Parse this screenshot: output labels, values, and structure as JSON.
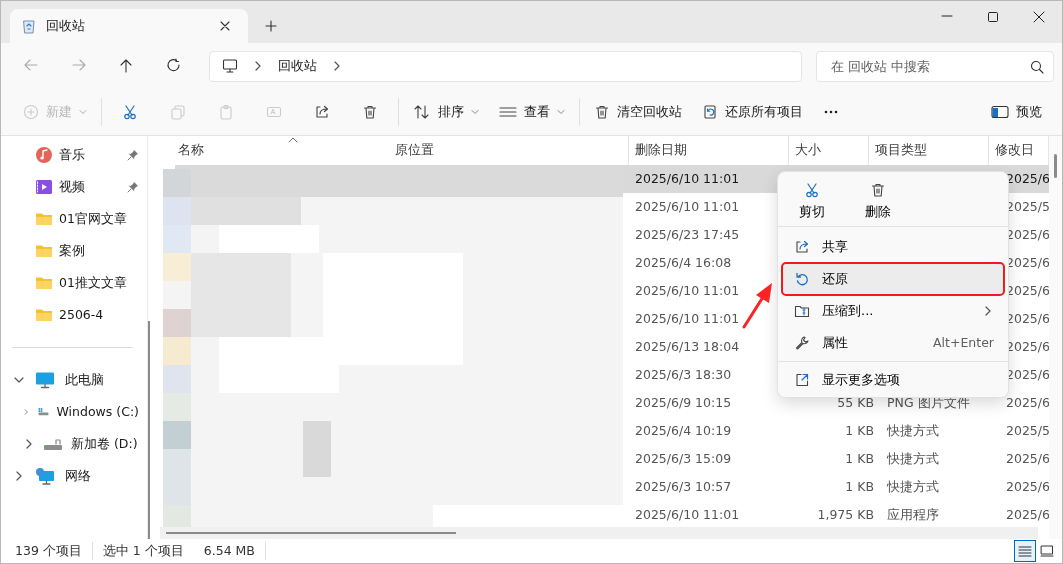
{
  "window": {
    "tab_title": "回收站"
  },
  "address": {
    "crumbs": [
      "回收站"
    ],
    "search_placeholder": "在 回收站 中搜索"
  },
  "toolbar": [
    {
      "kind": "new",
      "label": "新建",
      "disabled": true
    },
    {
      "kind": "cut",
      "disabled": false
    },
    {
      "kind": "copy",
      "disabled": true
    },
    {
      "kind": "paste",
      "disabled": true
    },
    {
      "kind": "rename",
      "disabled": true
    },
    {
      "kind": "share",
      "disabled": false
    },
    {
      "kind": "delete",
      "disabled": false
    },
    {
      "kind": "sort",
      "label": "排序",
      "disabled": false
    },
    {
      "kind": "view",
      "label": "查看",
      "disabled": false
    },
    {
      "kind": "empty",
      "label": "清空回收站",
      "disabled": false
    },
    {
      "kind": "restore_all",
      "label": "还原所有项目",
      "disabled": false
    },
    {
      "kind": "more",
      "disabled": false
    }
  ],
  "preview": {
    "label": "预览"
  },
  "sidebar": {
    "quick": [
      {
        "kind": "music",
        "label": "音乐",
        "pinned": true
      },
      {
        "kind": "video",
        "label": "视频",
        "pinned": true
      },
      {
        "kind": "folder",
        "label": "01官网文章",
        "pinned": false
      },
      {
        "kind": "folder",
        "label": "案例",
        "pinned": false
      },
      {
        "kind": "folder",
        "label": "01推文文章",
        "pinned": false
      },
      {
        "kind": "folder",
        "label": "2506-4",
        "pinned": false
      }
    ],
    "tree": [
      {
        "kind": "pc",
        "label": "此电脑",
        "expanded": true,
        "children": [
          {
            "kind": "drive_c",
            "label": "Windows (C:)",
            "expanded": false
          },
          {
            "kind": "drive",
            "label": "新加卷 (D:)",
            "expanded": false
          }
        ]
      },
      {
        "kind": "network",
        "label": "网络",
        "expanded": false
      }
    ]
  },
  "table": {
    "columns": [
      "名称",
      "原位置",
      "删除日期",
      "大小",
      "项目类型",
      "修改日"
    ],
    "rows": [
      {
        "deleted": "2025/6/10 11:01",
        "modified": "2025/6",
        "selected": true
      },
      {
        "deleted": "2025/6/10 11:01",
        "modified": "2025/5",
        "selected": false
      },
      {
        "deleted": "2025/6/23 17:45",
        "modified": "2025/6",
        "selected": false
      },
      {
        "deleted": "2025/6/4 16:08",
        "modified": "2025/6",
        "selected": false
      },
      {
        "deleted": "2025/6/10 11:01",
        "modified": "2025/6",
        "selected": false
      },
      {
        "deleted": "2025/6/10 11:01",
        "modified": "2025/6",
        "selected": false
      },
      {
        "deleted": "2025/6/13 18:04",
        "modified": "2025/6",
        "selected": false
      },
      {
        "deleted": "2025/6/3 18:30",
        "modified": "2025/6",
        "selected": false
      },
      {
        "deleted": "2025/6/9 10:15",
        "size": "55 KB",
        "type": "PNG 图片文件",
        "modified": "2025/6",
        "selected": false
      },
      {
        "deleted": "2025/6/4 10:19",
        "size": "1 KB",
        "type": "快捷方式",
        "modified": "2025/5",
        "selected": false
      },
      {
        "deleted": "2025/6/3 15:09",
        "size": "1 KB",
        "type": "快捷方式",
        "modified": "2025/6",
        "selected": false
      },
      {
        "deleted": "2025/6/3 10:57",
        "size": "1 KB",
        "type": "快捷方式",
        "modified": "2025/6",
        "selected": false
      },
      {
        "deleted": "2025/6/10 11:01",
        "size": "1,975 KB",
        "type": "应用程序",
        "modified": "2025/6",
        "selected": false
      }
    ]
  },
  "context_menu": {
    "top_actions": [
      {
        "kind": "cut",
        "label": "剪切"
      },
      {
        "kind": "delete",
        "label": "删除"
      }
    ],
    "items": [
      {
        "kind": "share",
        "label": "共享",
        "highlighted": false
      },
      {
        "kind": "restore",
        "label": "还原",
        "highlighted": true
      },
      {
        "kind": "compress",
        "label": "压缩到...",
        "submenu": true,
        "highlighted": false
      },
      {
        "kind": "properties",
        "label": "属性",
        "shortcut": "Alt+Enter",
        "highlighted": false
      },
      {
        "kind": "more_options",
        "label": "显示更多选项",
        "separator_before": true,
        "highlighted": false
      }
    ],
    "pointer_arrow": true
  },
  "status_bar": {
    "count": "139 个项目",
    "selection": "选中 1 个项目",
    "size": "6.54 MB",
    "views": [
      {
        "kind": "details",
        "selected": true
      },
      {
        "kind": "tiles",
        "selected": false
      }
    ]
  }
}
